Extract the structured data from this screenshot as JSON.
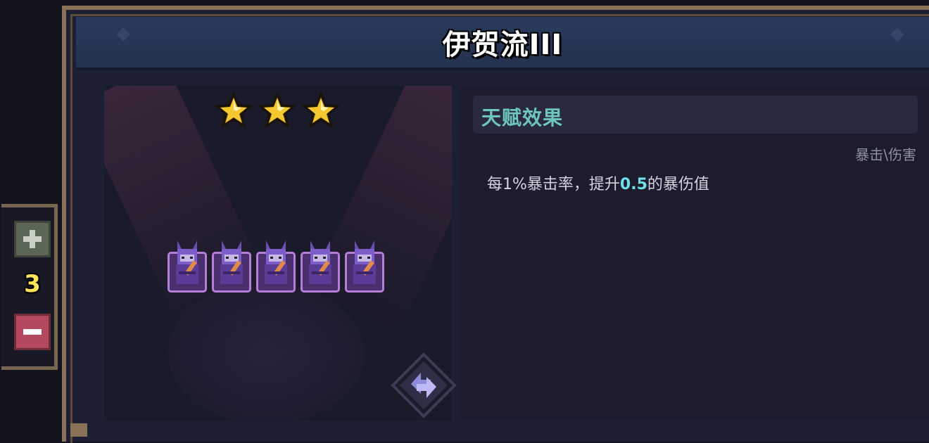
{
  "title": "伊贺流III",
  "stars": {
    "filled": 3,
    "total": 3,
    "icon": "star-icon",
    "color": "#f5c830"
  },
  "units": [
    {
      "icon": "purple-ninja-unit-icon"
    },
    {
      "icon": "purple-ninja-unit-icon"
    },
    {
      "icon": "purple-ninja-unit-icon"
    },
    {
      "icon": "purple-ninja-unit-icon"
    },
    {
      "icon": "purple-ninja-unit-icon"
    }
  ],
  "talent": {
    "header": "天赋效果",
    "tag": "暴击\\伤害",
    "desc_before": "每1%暴击率，提升",
    "desc_value": "0.5",
    "desc_after": "的暴伤值"
  },
  "counter": {
    "value": "3",
    "plus_icon": "plus-icon",
    "minus_icon": "minus-icon"
  },
  "refresh_icon": "refresh-swap-icon",
  "colors": {
    "accent_teal": "#6fc5c0",
    "highlight": "#6fe0e8",
    "count_yellow": "#ffe45a",
    "unit_border": "#b57ed8"
  }
}
